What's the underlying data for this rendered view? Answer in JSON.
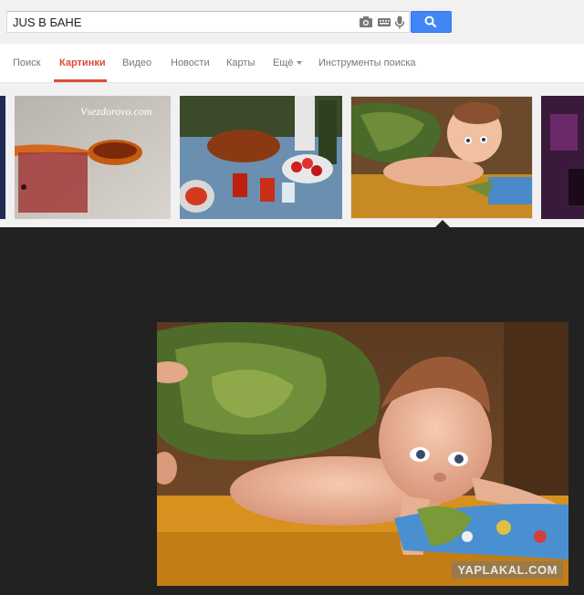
{
  "search": {
    "query": "JUS В БАНЕ"
  },
  "tabs": [
    {
      "label": "Поиск"
    },
    {
      "label": "Картинки"
    },
    {
      "label": "Видео"
    },
    {
      "label": "Новости"
    },
    {
      "label": "Карты"
    },
    {
      "label": "Ещё"
    },
    {
      "label": "Инструменты поиска"
    }
  ],
  "thumbnails": [
    {
      "name": "partial-left",
      "watermark": ""
    },
    {
      "name": "spoon",
      "watermark": "Vsezdorovo.com"
    },
    {
      "name": "food-table",
      "watermark": ""
    },
    {
      "name": "baby-sauna",
      "watermark": "",
      "selected": true
    },
    {
      "name": "partial-right",
      "watermark": ""
    }
  ],
  "preview": {
    "watermark": "YAPLAKAL.COM"
  },
  "colors": {
    "accent_red": "#dd4b39",
    "search_blue": "#4285f4",
    "preview_bg": "#222222"
  },
  "icons": [
    "camera-icon",
    "keyboard-icon",
    "microphone-icon",
    "search-icon"
  ]
}
